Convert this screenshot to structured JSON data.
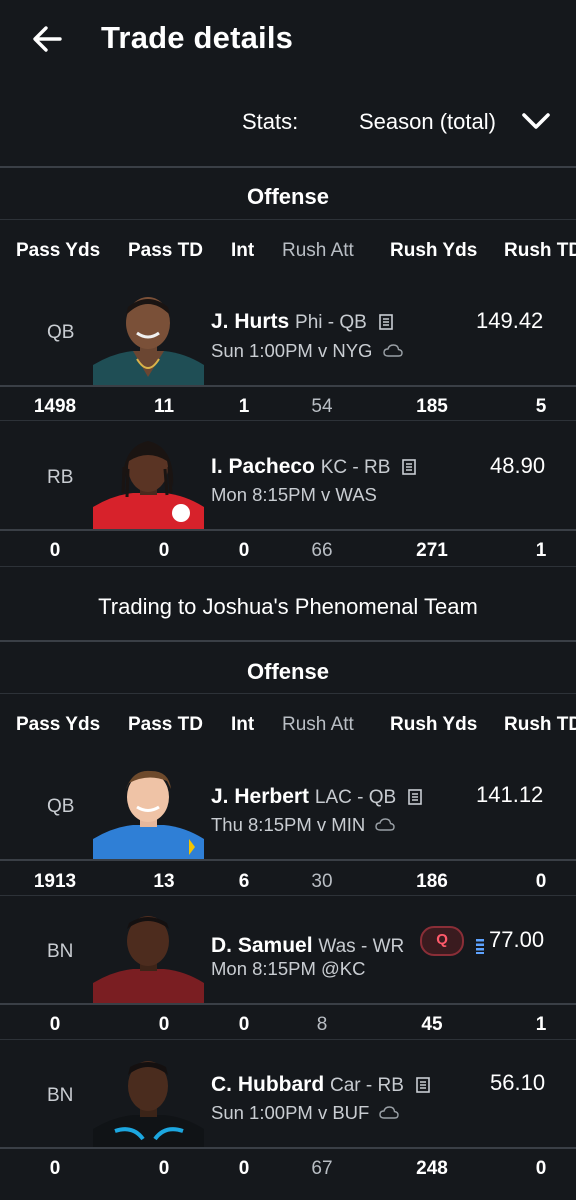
{
  "header": {
    "title": "Trade details",
    "back_icon": "arrow-left-icon"
  },
  "stats_filter": {
    "label": "Stats:",
    "value": "Season (total)"
  },
  "colors": {
    "bg": "#15181c",
    "divider": "#3a3f46",
    "injury": "#ff5a6b"
  },
  "sections": [
    {
      "title": "Offense",
      "columns": [
        "Pass Yds",
        "Pass TD",
        "Int",
        "Rush Att",
        "Rush Yds",
        "Rush TD"
      ],
      "players": [
        {
          "slot": "QB",
          "name": "J. Hurts",
          "team_pos": "Phi - QB",
          "game": "Sun 1:00PM v NYG",
          "score": "149.42",
          "stats": [
            "1498",
            "11",
            "1",
            "54",
            "185",
            "5"
          ]
        },
        {
          "slot": "RB",
          "name": "I. Pacheco",
          "team_pos": "KC - RB",
          "game": "Mon 8:15PM v WAS",
          "score": "48.90",
          "stats": [
            "0",
            "0",
            "0",
            "66",
            "271",
            "1"
          ]
        }
      ]
    },
    {
      "title": "Offense",
      "columns": [
        "Pass Yds",
        "Pass TD",
        "Int",
        "Rush Att",
        "Rush Yds",
        "Rush TD"
      ],
      "players": [
        {
          "slot": "QB",
          "name": "J. Herbert",
          "team_pos": "LAC - QB",
          "game": "Thu 8:15PM v MIN",
          "score": "141.12",
          "stats": [
            "1913",
            "13",
            "6",
            "30",
            "186",
            "0"
          ]
        },
        {
          "slot": "BN",
          "name": "D. Samuel",
          "team_pos": "Was - WR",
          "badge": "Q",
          "game": "Mon 8:15PM @KC",
          "score": "77.00",
          "stats": [
            "0",
            "0",
            "0",
            "8",
            "45",
            "1"
          ]
        },
        {
          "slot": "BN",
          "name": "C. Hubbard",
          "team_pos": "Car - RB",
          "game": "Sun 1:00PM v BUF",
          "score": "56.10",
          "stats": [
            "0",
            "0",
            "0",
            "67",
            "248",
            "0"
          ]
        }
      ]
    }
  ],
  "trading_to": "Trading to Joshua's Phenomenal Team"
}
